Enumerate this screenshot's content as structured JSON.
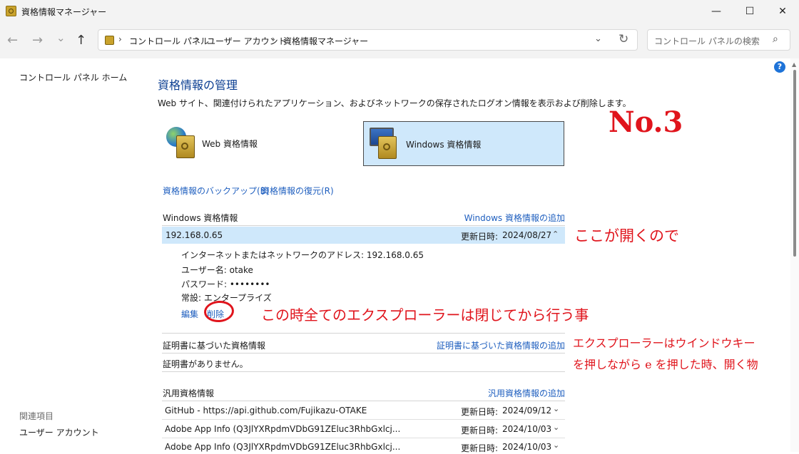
{
  "window": {
    "title": "資格情報マネージャー",
    "minimize": "—",
    "maximize": "☐",
    "close": "✕"
  },
  "nav": {
    "back": "←",
    "forward": "→",
    "recent": "⌄",
    "up": "↑",
    "breadcrumbs": [
      "コントロール パネル",
      "ユーザー アカウント",
      "資格情報マネージャー"
    ],
    "separator": "›",
    "search_placeholder": "コントロール パネルの検索"
  },
  "left_pane": {
    "home": "コントロール パネル ホーム",
    "related_header": "関連項目",
    "related_link": "ユーザー アカウント"
  },
  "help": "?",
  "main": {
    "heading": "資格情報の管理",
    "description": "Web サイト、関連付けられたアプリケーション、およびネットワークの保存されたログオン情報を表示および削除します。",
    "tiles": {
      "web": "Web 資格情報",
      "windows": "Windows 資格情報"
    },
    "backup_link": "資格情報のバックアップ(B)",
    "restore_link": "資格情報の復元(R)"
  },
  "windows_section": {
    "title": "Windows 資格情報",
    "add_link": "Windows 資格情報の追加",
    "open_row": {
      "name": "192.168.0.65",
      "date_label": "更新日時:",
      "date": "2024/08/27",
      "chevron": "⌃"
    },
    "details": {
      "address": "インターネットまたはネットワークのアドレス:  192.168.0.65",
      "username": "ユーザー名:  otake",
      "password": "パスワード:  ••••••••",
      "persistence": "常設:  エンタープライズ"
    },
    "edit": "編集",
    "delete": "削除"
  },
  "cert_section": {
    "title": "証明書に基づいた資格情報",
    "add_link": "証明書に基づいた資格情報の追加",
    "empty": "証明書がありません。"
  },
  "generic_section": {
    "title": "汎用資格情報",
    "add_link": "汎用資格情報の追加",
    "rows": [
      {
        "name": "GitHub - https://api.github.com/Fujikazu-OTAKE",
        "date_label": "更新日時:",
        "date": "2024/09/12",
        "chevron": "⌄"
      },
      {
        "name": "Adobe App Info (Q3JlYXRpdmVDbG91ZEluc3RhbGxlcj...",
        "date_label": "更新日時:",
        "date": "2024/10/03",
        "chevron": "⌄"
      },
      {
        "name": "Adobe App Info (Q3JlYXRpdmVDbG91ZEluc3RhbGxlcj...",
        "date_label": "更新日時:",
        "date": "2024/10/03",
        "chevron": "⌄"
      }
    ]
  },
  "annotations": {
    "step": "No.3",
    "opens_here": "ここが開くので",
    "close_explorers": "この時全てのエクスプローラーは閉じてから行う事",
    "explorer_line1": "エクスプローラーはウインドウキー",
    "explorer_line2": "を押しながら e を押した時、開く物",
    "color": "#e0141c"
  }
}
